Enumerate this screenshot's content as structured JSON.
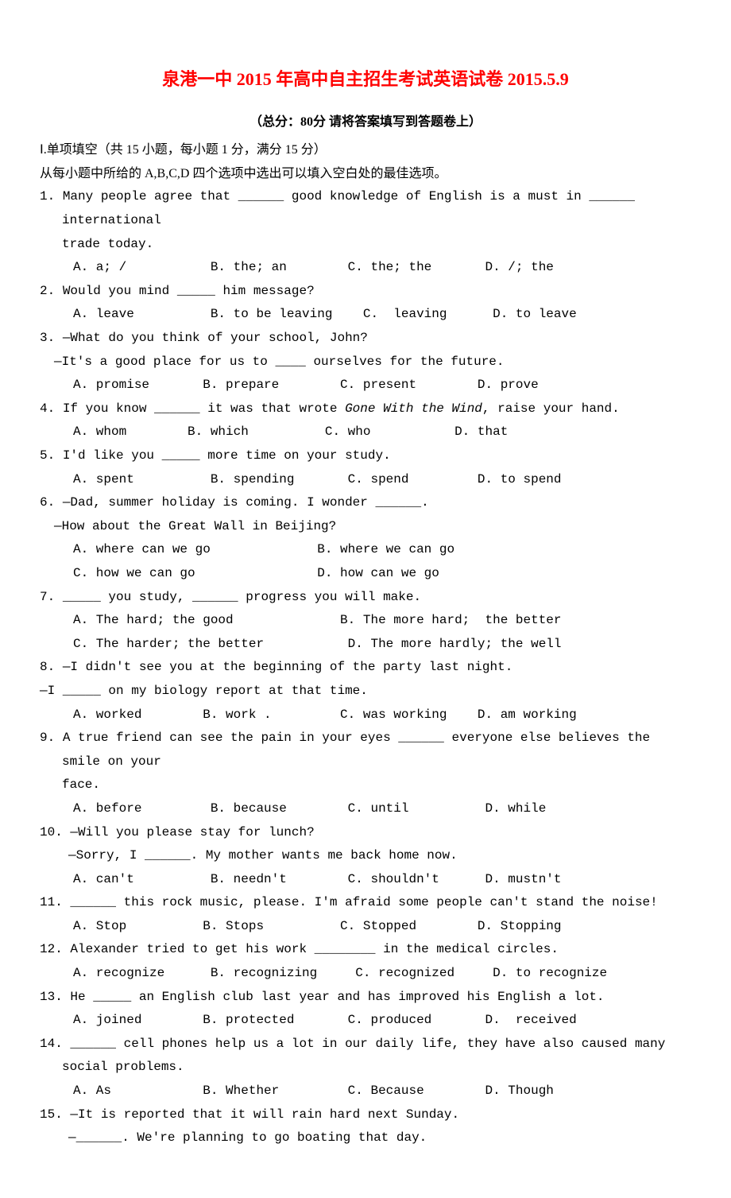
{
  "title": "泉港一中 2015 年高中自主招生考试英语试卷 2015.5.9",
  "subtitle": "（总分：80分  请将答案填写到答题卷上）",
  "section_header": "Ⅰ.单项填空（共 15 小题，每小题 1 分，满分 15 分）",
  "instruction": "从每小题中所给的 A,B,C,D 四个选项中选出可以填入空白处的最佳选项。",
  "questions": [
    {
      "num": "1.",
      "text": "Many people agree that ______ good knowledge of English is a must in ______ international",
      "cont": "trade today.",
      "options": "A. a; /           B. the; an        C. the; the       D. /; the"
    },
    {
      "num": "2.",
      "text": "Would you mind _____ him message?",
      "options": "A. leave          B. to be leaving    C.  leaving      D. to leave"
    },
    {
      "num": "3.",
      "text": "—What do you think of your school, John?",
      "sub": "—It's a good place for us to ____ ourselves for the future.",
      "options": "A. promise       B. prepare        C. present        D. prove"
    },
    {
      "num": "4.",
      "text": "If you know ______ it was that wrote ",
      "italic": "Gone With the Wind",
      "text_after": ", raise your hand.",
      "options": "A. whom        B. which          C. who           D. that"
    },
    {
      "num": "5.",
      "text": "I'd like you _____ more time on your study.",
      "options": "A. spent          B. spending       C. spend         D. to spend"
    },
    {
      "num": "6.",
      "text": "—Dad, summer holiday is coming. I wonder ______.",
      "sub": "—How about the Great Wall in Beijing?",
      "opt_line1": "A. where can we go              B. where we can go",
      "opt_line2": "C. how we can go                D. how can we go"
    },
    {
      "num": "7.",
      "text": "_____ you study, ______ progress you will make.",
      "opt_line1": "A. The hard; the good              B. The more hard;  the better",
      "opt_line2": "C. The harder; the better           D. The more hardly; the well"
    },
    {
      "num": "8.",
      "text": "—I didn't see you at the beginning of the party last night.",
      "sub_noindent": "—I _____ on my biology report at that time.",
      "options": "A. worked        B. work .         C. was working    D. am working"
    },
    {
      "num": "9.",
      "text": "A true friend can see the pain in your eyes ______ everyone else believes the smile on your",
      "cont": "face.",
      "options": "A. before         B. because        C. until          D. while"
    },
    {
      "num": "10.",
      "text": "—Will you please stay for lunch?",
      "sub_indent": "—Sorry, I ______. My mother wants me back home now.",
      "options": "A. can't          B. needn't        C. shouldn't      D. mustn't"
    },
    {
      "num": "11.",
      "text": "______ this rock music, please. I'm afraid some people can't stand the noise!",
      "options": "A. Stop          B. Stops          C. Stopped        D. Stopping"
    },
    {
      "num": "12.",
      "text": "Alexander tried to get his work ________ in the medical circles.",
      "options": "A. recognize      B. recognizing     C. recognized     D. to recognize"
    },
    {
      "num": "13.",
      "text": "He _____ an English club last year and has improved his English a lot.",
      "options": "A. joined        B. protected       C. produced       D.  received"
    },
    {
      "num": "14.",
      "text": "______ cell phones help us a lot in our daily life, they have also caused many social problems.",
      "options": "A. As            B. Whether         C. Because        D. Though"
    },
    {
      "num": "15.",
      "text": "—It is reported that it will rain hard next Sunday.",
      "sub_indent": "—______. We're planning to go boating that day."
    }
  ]
}
